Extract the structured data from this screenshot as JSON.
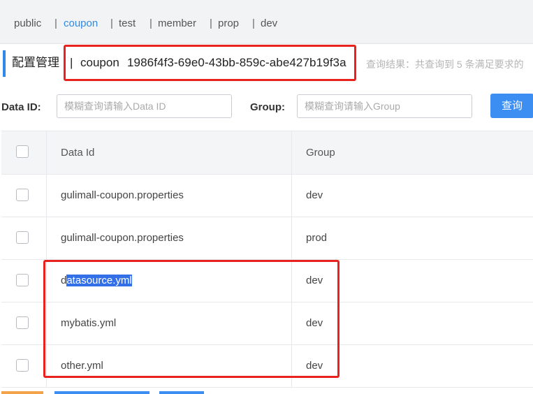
{
  "namespaces": [
    {
      "label": "public",
      "active": false
    },
    {
      "label": "coupon",
      "active": true
    },
    {
      "label": "test",
      "active": false
    },
    {
      "label": "member",
      "active": false
    },
    {
      "label": "prop",
      "active": false
    },
    {
      "label": "dev",
      "active": false
    }
  ],
  "ns_separator": "|",
  "header": {
    "title": "配置管理",
    "separator": "|",
    "namespace_name": "coupon",
    "namespace_id": "1986f4f3-69e0-43bb-859c-abe427b19f3a",
    "result_info": "查询结果：共查询到 5 条满足要求的"
  },
  "search": {
    "data_id_label": "Data ID:",
    "data_id_placeholder": "模糊查询请输入Data ID",
    "group_label": "Group:",
    "group_placeholder": "模糊查询请输入Group",
    "query_button": "查询"
  },
  "table": {
    "columns": [
      "Data Id",
      "Group"
    ],
    "rows": [
      {
        "data_id": "gulimall-coupon.properties",
        "group": "dev"
      },
      {
        "data_id": "gulimall-coupon.properties",
        "group": "prod"
      },
      {
        "data_id_prefix": "d",
        "data_id_selected": "atasource.yml",
        "group": "dev"
      },
      {
        "data_id": "mybatis.yml",
        "group": "dev"
      },
      {
        "data_id": "other.yml",
        "group": "dev"
      }
    ]
  },
  "colors": {
    "accent": "#2e8ae6",
    "highlight_box": "#e8221f",
    "button": "#3d8ef2",
    "selection": "#3370e8"
  }
}
